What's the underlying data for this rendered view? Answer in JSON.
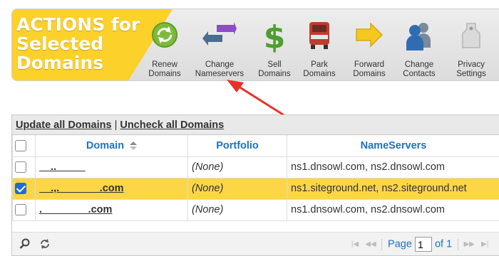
{
  "toolbar": {
    "title": "ACTIONS for\nSelected\nDomains",
    "actions": [
      {
        "label": "Renew\nDomains",
        "icon": "renew-icon"
      },
      {
        "label": "Change\nNameservers",
        "icon": "change-nameservers-icon"
      },
      {
        "label": "Sell\nDomains",
        "icon": "dollar-icon"
      },
      {
        "label": "Park\nDomains",
        "icon": "truck-icon"
      },
      {
        "label": "Forward\nDomains",
        "icon": "forward-arrow-icon"
      },
      {
        "label": "Change\nContacts",
        "icon": "contacts-icon"
      },
      {
        "label": "Privacy\nSettings",
        "icon": "privacy-tag-icon"
      }
    ]
  },
  "bulk_links": {
    "update_all": "Update all Domains",
    "separator": "|",
    "uncheck_all": "Uncheck all Domains"
  },
  "table": {
    "columns": [
      "Domain",
      "Portfolio",
      "NameServers"
    ],
    "rows": [
      {
        "checked": false,
        "domain": "__.._____",
        "portfolio": "(None)",
        "nameservers": "ns1.dnsowl.com, ns2.dnsowl.com"
      },
      {
        "checked": true,
        "domain": "__.,._______.com",
        "portfolio": "(None)",
        "nameservers": "ns1.siteground.net, ns2.siteground.net"
      },
      {
        "checked": false,
        "domain": ".________.com",
        "portfolio": "(None)",
        "nameservers": "ns1.dnsowl.com, ns2.dnsowl.com"
      }
    ]
  },
  "pager": {
    "page_label": "Page",
    "page_value": "1",
    "of_label": "of 1"
  },
  "colors": {
    "accent_yellow": "#fcd12a",
    "link_blue": "#1a73c7",
    "checkbox_blue": "#1b6ed4",
    "annotation_red": "#e8312b"
  }
}
